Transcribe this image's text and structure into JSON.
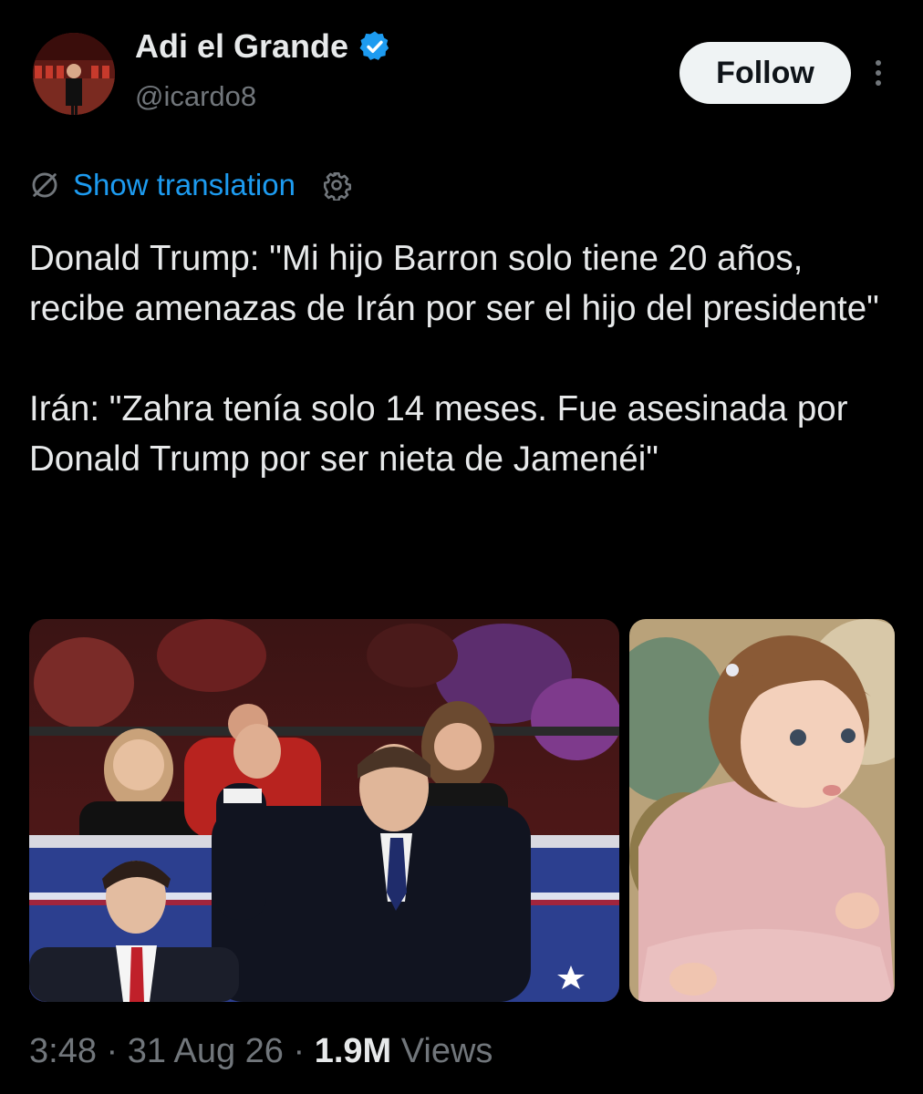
{
  "author": {
    "display_name": "Adi el Grande",
    "handle": "@icardo8",
    "verified": true,
    "verified_color": "#1d9bf0"
  },
  "follow_label": "Follow",
  "translation": {
    "link_text": "Show translation",
    "link_color": "#1d9bf0"
  },
  "tweet": {
    "paragraphs": [
      "Donald Trump: \"Mi hijo Barron solo tiene 20 años, recibe amenazas de Irán por ser el hijo del presidente\"",
      "Irán: \"Zahra tenía solo 14 meses. Fue asesinada por Donald Trump por ser nieta de Jamenéi\""
    ]
  },
  "meta": {
    "time": "3:48",
    "separator": " · ",
    "date": "31 Aug 26",
    "views_count": "1.9M",
    "views_label": " Views"
  },
  "icons": {
    "verified": "verified-badge-icon",
    "more": "more-options-icon",
    "translate": "translate-icon",
    "settings": "settings-gear-icon"
  },
  "colors": {
    "background": "#000000",
    "text_primary": "#e7e9ea",
    "text_secondary": "#71767b",
    "follow_bg": "#eff3f4"
  }
}
